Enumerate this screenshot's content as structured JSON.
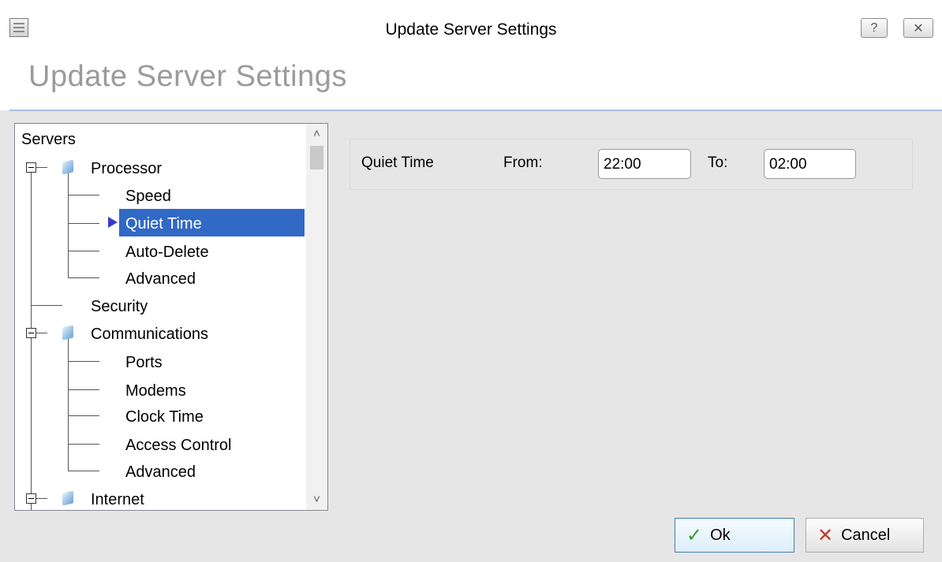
{
  "window": {
    "title": "Update Server Settings",
    "help_button": "?",
    "close_button": "✕"
  },
  "header": {
    "title": "Update Server Settings"
  },
  "tree": {
    "root": "Servers",
    "items": [
      {
        "label": "Processor"
      },
      {
        "label": "Speed"
      },
      {
        "label": "Quiet Time",
        "selected": true
      },
      {
        "label": "Auto-Delete"
      },
      {
        "label": "Advanced"
      },
      {
        "label": "Security"
      },
      {
        "label": "Communications"
      },
      {
        "label": "Ports"
      },
      {
        "label": "Modems"
      },
      {
        "label": "Clock Time"
      },
      {
        "label": "Access Control"
      },
      {
        "label": "Advanced"
      },
      {
        "label": "Internet"
      }
    ],
    "scroll_up": "˄",
    "scroll_down": "˅"
  },
  "quiet_time": {
    "label": "Quiet Time",
    "from_label": "From:",
    "from_value": "22:00",
    "to_label": "To:",
    "to_value": "02:00"
  },
  "buttons": {
    "ok": "Ok",
    "cancel": "Cancel",
    "ok_icon": "check-icon",
    "cancel_icon": "x-icon"
  },
  "colors": {
    "selection": "#3169c6",
    "header_line": "#aebde0",
    "ok_check": "#3a9a3a",
    "cancel_x": "#c0392b"
  }
}
